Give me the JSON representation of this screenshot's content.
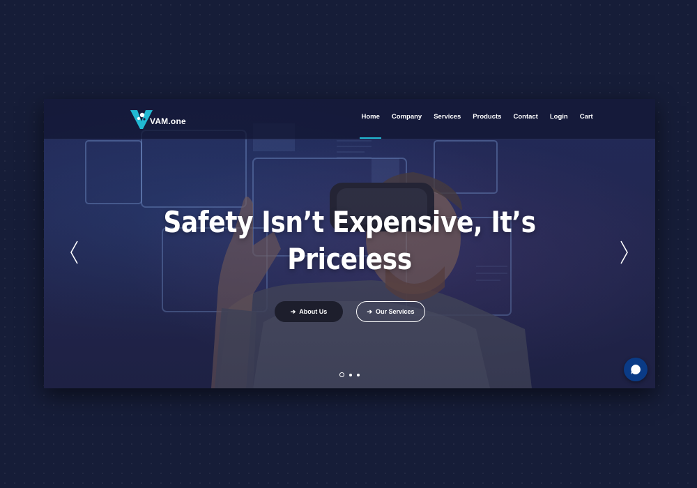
{
  "brand": {
    "name": "VAM.one",
    "accent_color": "#21b9d3"
  },
  "nav": {
    "items": [
      {
        "label": "Home",
        "active": true
      },
      {
        "label": "Company",
        "active": false
      },
      {
        "label": "Services",
        "active": false
      },
      {
        "label": "Products",
        "active": false
      },
      {
        "label": "Contact",
        "active": false
      },
      {
        "label": "Login",
        "active": false
      },
      {
        "label": "Cart",
        "active": false
      }
    ]
  },
  "hero": {
    "headline_line1": "Safety Isn’t Expensive, It’s",
    "headline_line2": "Priceless",
    "about_button": "About Us",
    "services_button": "Our Services",
    "slide_count": 3,
    "active_slide": 1
  },
  "icons": {
    "prev": "chevron-left-icon",
    "next": "chevron-right-icon",
    "button_arrow": "arrow-right-icon",
    "chat": "chat-icon"
  },
  "colors": {
    "page_background": "#161d38",
    "chat_button": "#0a3b86",
    "about_button": "#1d1e2c"
  }
}
